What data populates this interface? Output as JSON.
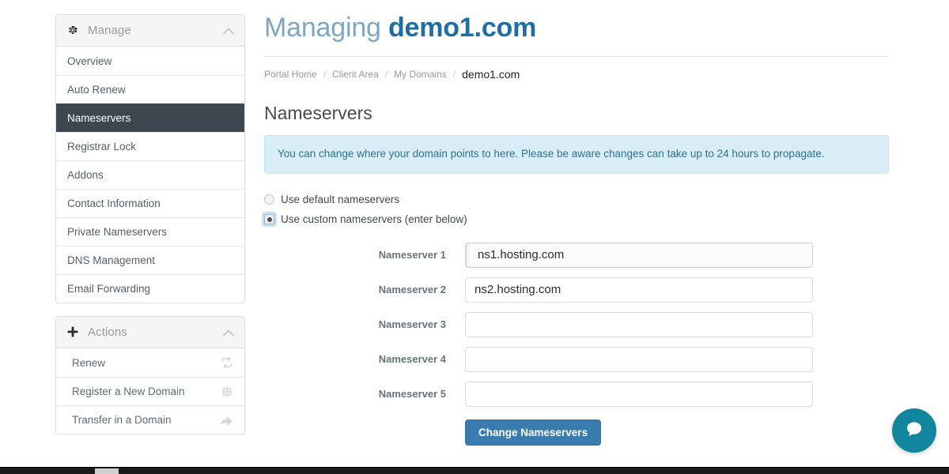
{
  "header": {
    "title_prefix": "Managing",
    "domain": "demo1.com"
  },
  "breadcrumb": {
    "items": [
      {
        "label": "Portal Home",
        "current": false
      },
      {
        "label": "Client Area",
        "current": false
      },
      {
        "label": "My Domains",
        "current": false
      },
      {
        "label": "demo1.com",
        "current": true
      }
    ],
    "separator": "/"
  },
  "sidebar": {
    "manage": {
      "title": "Manage",
      "icon": "gear-icon",
      "toggle_icon": "chevron-up-icon",
      "items": [
        {
          "label": "Overview",
          "active": false
        },
        {
          "label": "Auto Renew",
          "active": false
        },
        {
          "label": "Nameservers",
          "active": true
        },
        {
          "label": "Registrar Lock",
          "active": false
        },
        {
          "label": "Addons",
          "active": false
        },
        {
          "label": "Contact Information",
          "active": false
        },
        {
          "label": "Private Nameservers",
          "active": false
        },
        {
          "label": "DNS Management",
          "active": false
        },
        {
          "label": "Email Forwarding",
          "active": false
        }
      ]
    },
    "actions": {
      "title": "Actions",
      "icon": "plus-icon",
      "toggle_icon": "chevron-up-icon",
      "items": [
        {
          "label": "Renew",
          "icon": "refresh-icon"
        },
        {
          "label": "Register a New Domain",
          "icon": "globe-icon"
        },
        {
          "label": "Transfer in a Domain",
          "icon": "share-arrow-icon"
        }
      ]
    }
  },
  "main": {
    "section_title": "Nameservers",
    "alert": "You can change where your domain points to here. Please be aware changes can take up to 24 hours to propagate.",
    "radios": [
      {
        "label": "Use default nameservers",
        "checked": false
      },
      {
        "label": "Use custom nameservers (enter below)",
        "checked": true
      }
    ],
    "fields": [
      {
        "label": "Nameserver 1",
        "value": "ns1.hosting.com",
        "placeholder": "",
        "focused": true
      },
      {
        "label": "Nameserver 2",
        "value": "ns2.hosting.com",
        "placeholder": "",
        "focused": false
      },
      {
        "label": "Nameserver 3",
        "value": "",
        "placeholder": "",
        "focused": false
      },
      {
        "label": "Nameserver 4",
        "value": "",
        "placeholder": "",
        "focused": false
      },
      {
        "label": "Nameserver 5",
        "value": "",
        "placeholder": "",
        "focused": false
      }
    ],
    "submit_label": "Change Nameservers"
  },
  "chat": {
    "icon": "chat-bubble-icon",
    "label": "Open chat"
  },
  "colors": {
    "accent_blue": "#1c6ea4",
    "title_light_blue": "#7ba7c7",
    "active_sidebar": "#3e4750",
    "alert_bg": "#d9edf7",
    "alert_border": "#bce8f1",
    "alert_text": "#31708f",
    "button_blue": "#3b7cb0",
    "chat_teal": "#12869c"
  }
}
